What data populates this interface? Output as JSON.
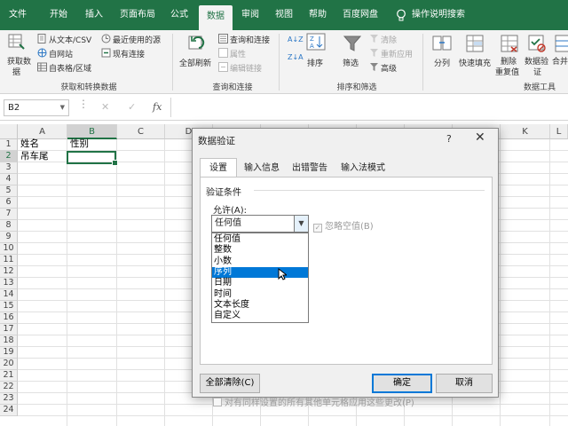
{
  "menu": {
    "items": [
      "文件",
      "开始",
      "插入",
      "页面布局",
      "公式",
      "数据",
      "审阅",
      "视图",
      "帮助",
      "百度网盘"
    ],
    "active": "数据",
    "tell_me": "操作说明搜索"
  },
  "ribbon": {
    "get_data": {
      "line1": "获取数",
      "line2": "据"
    },
    "from_text_csv": "从文本/CSV",
    "from_web": "自网站",
    "from_table": "自表格/区域",
    "recent_sources": "最近使用的源",
    "existing_connections": "现有连接",
    "group_get_transform": "获取和转换数据",
    "refresh_all": "全部刷新",
    "queries_connections": "查询和连接",
    "properties": "属性",
    "edit_links": "编辑链接",
    "group_queries": "查询和连接",
    "sort_az": "A↓Z",
    "sort_za": "Z↓A",
    "sort": "排序",
    "filter": "筛选",
    "clear": "清除",
    "reapply": "重新应用",
    "advanced": "高级",
    "group_sort_filter": "排序和筛选",
    "text_to_columns": "分列",
    "flash_fill": "快速填充",
    "remove_duplicates": {
      "line1": "删除",
      "line2": "重复值"
    },
    "data_validation": {
      "line1": "数据验",
      "line2": "证"
    },
    "consolidate": "合并",
    "group_data_tools": "数据工具"
  },
  "formula_bar": {
    "name_box": "B2",
    "cancel": "✕",
    "confirm": "✓",
    "fx": "fx"
  },
  "grid": {
    "columns": [
      "A",
      "B",
      "C",
      "D",
      "E",
      "F",
      "G",
      "H",
      "I",
      "J",
      "K",
      "L"
    ],
    "selected_column": "B",
    "rows": [
      "1",
      "2",
      "3",
      "4",
      "5",
      "6",
      "7",
      "8",
      "9",
      "10",
      "11",
      "12",
      "13",
      "14",
      "15",
      "16",
      "17",
      "18",
      "19",
      "20",
      "21",
      "22",
      "23",
      "24"
    ],
    "selected_row": "2",
    "cells": {
      "A1": "姓名",
      "B1": "性别",
      "A2": "吊车尾"
    }
  },
  "dialog": {
    "title": "数据验证",
    "help": "?",
    "close": "✕",
    "tabs": [
      "设置",
      "输入信息",
      "出错警告",
      "输入法模式"
    ],
    "active_tab": "设置",
    "criteria_title": "验证条件",
    "allow_label": "允许(A):",
    "allow_value": "任何值",
    "ignore_blank": "忽略空值(B)",
    "options": [
      "任何值",
      "整数",
      "小数",
      "序列",
      "日期",
      "时间",
      "文本长度",
      "自定义"
    ],
    "highlighted_option": "序列",
    "apply_all": "对有同样设置的所有其他单元格应用这些更改(P)",
    "clear_all": "全部清除(C)",
    "ok": "确定",
    "cancel": "取消"
  },
  "colors": {
    "excel_green": "#217346",
    "highlight": "#0078d7"
  }
}
